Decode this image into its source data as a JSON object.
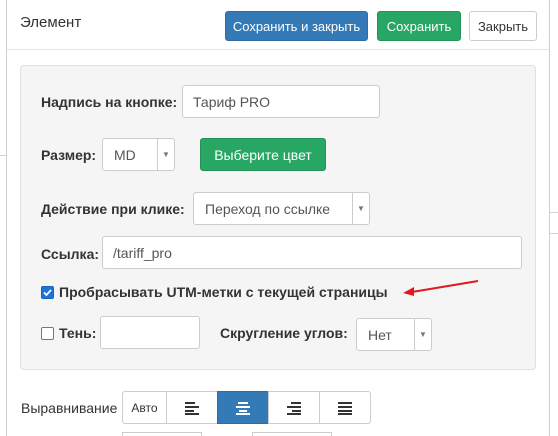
{
  "modal": {
    "title": "Элемент",
    "buttons": {
      "save_close": "Сохранить и закрыть",
      "save": "Сохранить",
      "close": "Закрыть"
    }
  },
  "form": {
    "button_text": {
      "label": "Надпись на кнопке:",
      "value": "Тариф PRO"
    },
    "size": {
      "label": "Размер:",
      "value": "MD",
      "color_button": "Выберите цвет"
    },
    "click_action": {
      "label": "Действие при клике:",
      "value": "Переход по ссылке"
    },
    "link": {
      "label": "Ссылка:",
      "value": "/tariff_pro"
    },
    "utm": {
      "label": "Пробрасывать UTM-метки с текущей страницы",
      "checked": true
    },
    "shadow": {
      "label": "Тень:",
      "checked": false,
      "value": ""
    },
    "corner_radius": {
      "label": "Скругление углов:",
      "value": "Нет"
    }
  },
  "alignment": {
    "label": "Выравнивание",
    "auto": "Авто",
    "options": [
      "align-left-icon",
      "align-center-icon",
      "align-right-icon",
      "align-justify-icon"
    ],
    "selected": "align-center-icon"
  },
  "colors": {
    "primary": "#337ab7",
    "success": "#28a764",
    "annotation_arrow": "#e0191e",
    "checkbox": "#1e72d8"
  }
}
